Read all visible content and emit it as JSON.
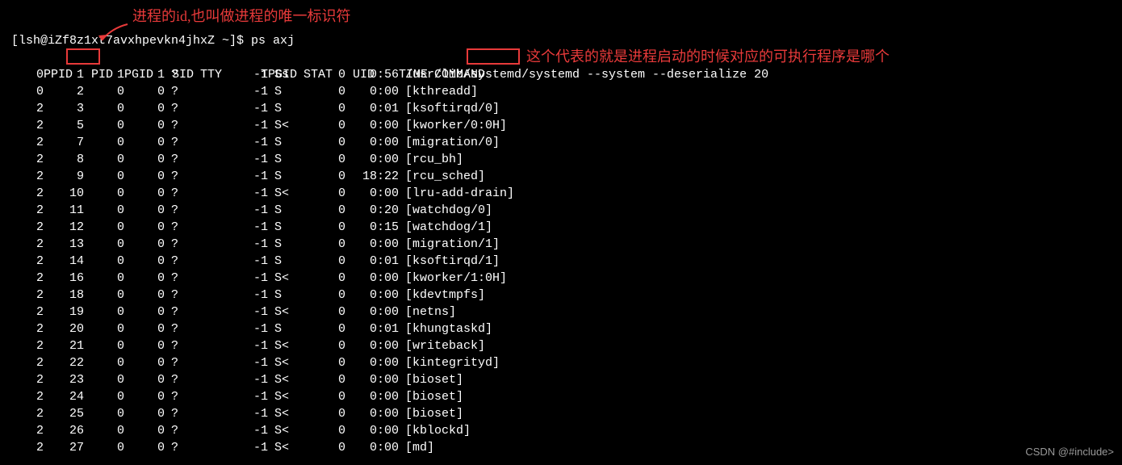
{
  "annotations": {
    "pid_note": "进程的id,也叫做进程的唯一标识符",
    "command_note": "这个代表的就是进程启动的时候对应的可执行程序是哪个"
  },
  "prompt": "[lsh@iZf8z1xt7avxhpevkn4jhxZ ~]$ ps axj",
  "headers": {
    "ppid": "PPID",
    "pid": "PID",
    "pgid": "PGID",
    "sid": "SID",
    "tty": "TTY",
    "tpgid": "TPGID",
    "stat": "STAT",
    "uid": "UID",
    "time": "TIME",
    "command": "COMMAND"
  },
  "rows": [
    {
      "ppid": "0",
      "pid": "1",
      "pgid": "1",
      "sid": "1",
      "tty": "?",
      "tpgid": "-1",
      "stat": "Ss",
      "uid": "0",
      "time": "0:56",
      "cmd": "/usr/lib/systemd/systemd --system --deserialize 20"
    },
    {
      "ppid": "0",
      "pid": "2",
      "pgid": "0",
      "sid": "0",
      "tty": "?",
      "tpgid": "-1",
      "stat": "S",
      "uid": "0",
      "time": "0:00",
      "cmd": "[kthreadd]"
    },
    {
      "ppid": "2",
      "pid": "3",
      "pgid": "0",
      "sid": "0",
      "tty": "?",
      "tpgid": "-1",
      "stat": "S",
      "uid": "0",
      "time": "0:01",
      "cmd": "[ksoftirqd/0]"
    },
    {
      "ppid": "2",
      "pid": "5",
      "pgid": "0",
      "sid": "0",
      "tty": "?",
      "tpgid": "-1",
      "stat": "S<",
      "uid": "0",
      "time": "0:00",
      "cmd": "[kworker/0:0H]"
    },
    {
      "ppid": "2",
      "pid": "7",
      "pgid": "0",
      "sid": "0",
      "tty": "?",
      "tpgid": "-1",
      "stat": "S",
      "uid": "0",
      "time": "0:00",
      "cmd": "[migration/0]"
    },
    {
      "ppid": "2",
      "pid": "8",
      "pgid": "0",
      "sid": "0",
      "tty": "?",
      "tpgid": "-1",
      "stat": "S",
      "uid": "0",
      "time": "0:00",
      "cmd": "[rcu_bh]"
    },
    {
      "ppid": "2",
      "pid": "9",
      "pgid": "0",
      "sid": "0",
      "tty": "?",
      "tpgid": "-1",
      "stat": "S",
      "uid": "0",
      "time": "18:22",
      "cmd": "[rcu_sched]"
    },
    {
      "ppid": "2",
      "pid": "10",
      "pgid": "0",
      "sid": "0",
      "tty": "?",
      "tpgid": "-1",
      "stat": "S<",
      "uid": "0",
      "time": "0:00",
      "cmd": "[lru-add-drain]"
    },
    {
      "ppid": "2",
      "pid": "11",
      "pgid": "0",
      "sid": "0",
      "tty": "?",
      "tpgid": "-1",
      "stat": "S",
      "uid": "0",
      "time": "0:20",
      "cmd": "[watchdog/0]"
    },
    {
      "ppid": "2",
      "pid": "12",
      "pgid": "0",
      "sid": "0",
      "tty": "?",
      "tpgid": "-1",
      "stat": "S",
      "uid": "0",
      "time": "0:15",
      "cmd": "[watchdog/1]"
    },
    {
      "ppid": "2",
      "pid": "13",
      "pgid": "0",
      "sid": "0",
      "tty": "?",
      "tpgid": "-1",
      "stat": "S",
      "uid": "0",
      "time": "0:00",
      "cmd": "[migration/1]"
    },
    {
      "ppid": "2",
      "pid": "14",
      "pgid": "0",
      "sid": "0",
      "tty": "?",
      "tpgid": "-1",
      "stat": "S",
      "uid": "0",
      "time": "0:01",
      "cmd": "[ksoftirqd/1]"
    },
    {
      "ppid": "2",
      "pid": "16",
      "pgid": "0",
      "sid": "0",
      "tty": "?",
      "tpgid": "-1",
      "stat": "S<",
      "uid": "0",
      "time": "0:00",
      "cmd": "[kworker/1:0H]"
    },
    {
      "ppid": "2",
      "pid": "18",
      "pgid": "0",
      "sid": "0",
      "tty": "?",
      "tpgid": "-1",
      "stat": "S",
      "uid": "0",
      "time": "0:00",
      "cmd": "[kdevtmpfs]"
    },
    {
      "ppid": "2",
      "pid": "19",
      "pgid": "0",
      "sid": "0",
      "tty": "?",
      "tpgid": "-1",
      "stat": "S<",
      "uid": "0",
      "time": "0:00",
      "cmd": "[netns]"
    },
    {
      "ppid": "2",
      "pid": "20",
      "pgid": "0",
      "sid": "0",
      "tty": "?",
      "tpgid": "-1",
      "stat": "S",
      "uid": "0",
      "time": "0:01",
      "cmd": "[khungtaskd]"
    },
    {
      "ppid": "2",
      "pid": "21",
      "pgid": "0",
      "sid": "0",
      "tty": "?",
      "tpgid": "-1",
      "stat": "S<",
      "uid": "0",
      "time": "0:00",
      "cmd": "[writeback]"
    },
    {
      "ppid": "2",
      "pid": "22",
      "pgid": "0",
      "sid": "0",
      "tty": "?",
      "tpgid": "-1",
      "stat": "S<",
      "uid": "0",
      "time": "0:00",
      "cmd": "[kintegrityd]"
    },
    {
      "ppid": "2",
      "pid": "23",
      "pgid": "0",
      "sid": "0",
      "tty": "?",
      "tpgid": "-1",
      "stat": "S<",
      "uid": "0",
      "time": "0:00",
      "cmd": "[bioset]"
    },
    {
      "ppid": "2",
      "pid": "24",
      "pgid": "0",
      "sid": "0",
      "tty": "?",
      "tpgid": "-1",
      "stat": "S<",
      "uid": "0",
      "time": "0:00",
      "cmd": "[bioset]"
    },
    {
      "ppid": "2",
      "pid": "25",
      "pgid": "0",
      "sid": "0",
      "tty": "?",
      "tpgid": "-1",
      "stat": "S<",
      "uid": "0",
      "time": "0:00",
      "cmd": "[bioset]"
    },
    {
      "ppid": "2",
      "pid": "26",
      "pgid": "0",
      "sid": "0",
      "tty": "?",
      "tpgid": "-1",
      "stat": "S<",
      "uid": "0",
      "time": "0:00",
      "cmd": "[kblockd]"
    },
    {
      "ppid": "2",
      "pid": "27",
      "pgid": "0",
      "sid": "0",
      "tty": "?",
      "tpgid": "-1",
      "stat": "S<",
      "uid": "0",
      "time": "0:00",
      "cmd": "[md]"
    }
  ],
  "watermark": "CSDN @#include>"
}
